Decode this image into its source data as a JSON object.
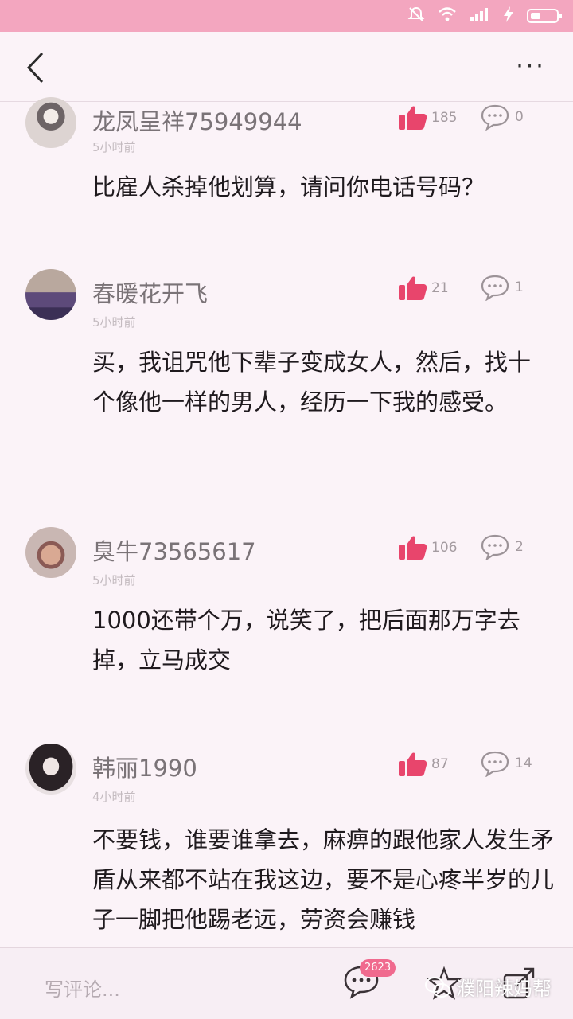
{
  "nav": {
    "back_icon": "chevron-left-icon",
    "more_label": "···"
  },
  "comments": [
    {
      "username": "龙凤呈祥75949944",
      "time": "5小时前",
      "likes": "185",
      "replies": "0",
      "text": "比雇人杀掉他划算，请问你电话号码？"
    },
    {
      "username": "春暖花开飞",
      "time": "5小时前",
      "likes": "21",
      "replies": "1",
      "text": "买，我诅咒他下辈子变成女人，然后，找十个像他一样的男人，经历一下我的感受。"
    },
    {
      "username": "臭牛73565617",
      "time": "5小时前",
      "likes": "106",
      "replies": "2",
      "text": "1000还带个万，说笑了，把后面那万字去掉，立马成交"
    },
    {
      "username": "韩丽1990",
      "time": "4小时前",
      "likes": "87",
      "replies": "14",
      "text": "不要钱，谁要谁拿去，麻痹的跟他家人发生矛盾从来都不站在我这边，要不是心疼半岁的儿子一脚把他踢老远，劳资会赚钱"
    }
  ],
  "bottom": {
    "write_placeholder": "写评论...",
    "comment_badge": "2623",
    "watermark": "濮阳辣妈帮"
  },
  "colors": {
    "status_bar": "#f3a6bf",
    "like": "#e8456c",
    "background": "#fbf3f8"
  }
}
